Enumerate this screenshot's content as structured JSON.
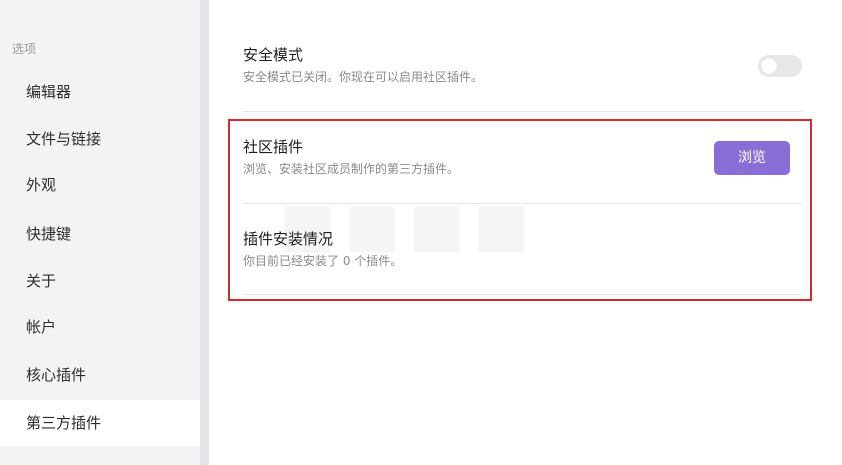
{
  "sidebar": {
    "section_label": "选项",
    "items": [
      {
        "label": "编辑器"
      },
      {
        "label": "文件与链接"
      },
      {
        "label": "外观"
      },
      {
        "label": "快捷键"
      },
      {
        "label": "关于"
      },
      {
        "label": "帐户"
      },
      {
        "label": "核心插件"
      },
      {
        "label": "第三方插件",
        "active": true
      }
    ]
  },
  "main": {
    "safe_mode": {
      "title": "安全模式",
      "description": "安全模式已关闭。你现在可以启用社区插件。",
      "enabled": false
    },
    "community_plugins": {
      "title": "社区插件",
      "description": "浏览、安装社区成员制作的第三方插件。",
      "button_label": "浏览"
    },
    "installed_plugins": {
      "title": "插件安装情况",
      "description": "你目前已经安装了 0 个插件。"
    }
  },
  "colors": {
    "accent": "#8a6ed8",
    "highlight_border": "#d9272a",
    "sidebar_bg": "#f2f3f5"
  }
}
